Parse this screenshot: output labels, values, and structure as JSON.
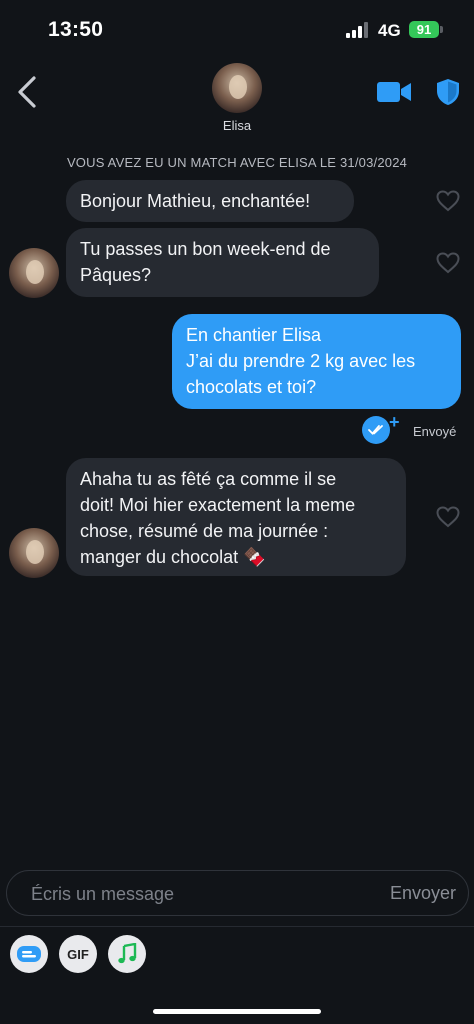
{
  "status_bar": {
    "time": "13:50",
    "network": "4G",
    "battery": "91"
  },
  "header": {
    "contact_name": "Elisa"
  },
  "match_banner": "VOUS AVEZ EU UN MATCH AVEC ELISA LE 31/03/2024",
  "messages": [
    {
      "from": "Elisa",
      "text": "Bonjour Mathieu, enchantée!"
    },
    {
      "from": "Elisa",
      "text": "Tu passes un bon week-end de\nPâques?"
    },
    {
      "from": "me",
      "text": "En chantier Elisa\nJ’ai du prendre 2 kg avec les\nchocolats et toi?",
      "status": "Envoyé"
    },
    {
      "from": "Elisa",
      "text": "Ahaha tu as fêté ça comme il se\ndoit! Moi hier exactement la meme\nchose, résumé de ma journée :\nmanger du chocolat 🍫"
    }
  ],
  "composer": {
    "placeholder": "Écris un message",
    "send_label": "Envoyer"
  },
  "toolbar": {
    "gif_label": "GIF"
  },
  "colors": {
    "background": "#111418",
    "incoming": "#262a31",
    "outgoing": "#2f9cf6",
    "accent": "#2f9cf6"
  }
}
